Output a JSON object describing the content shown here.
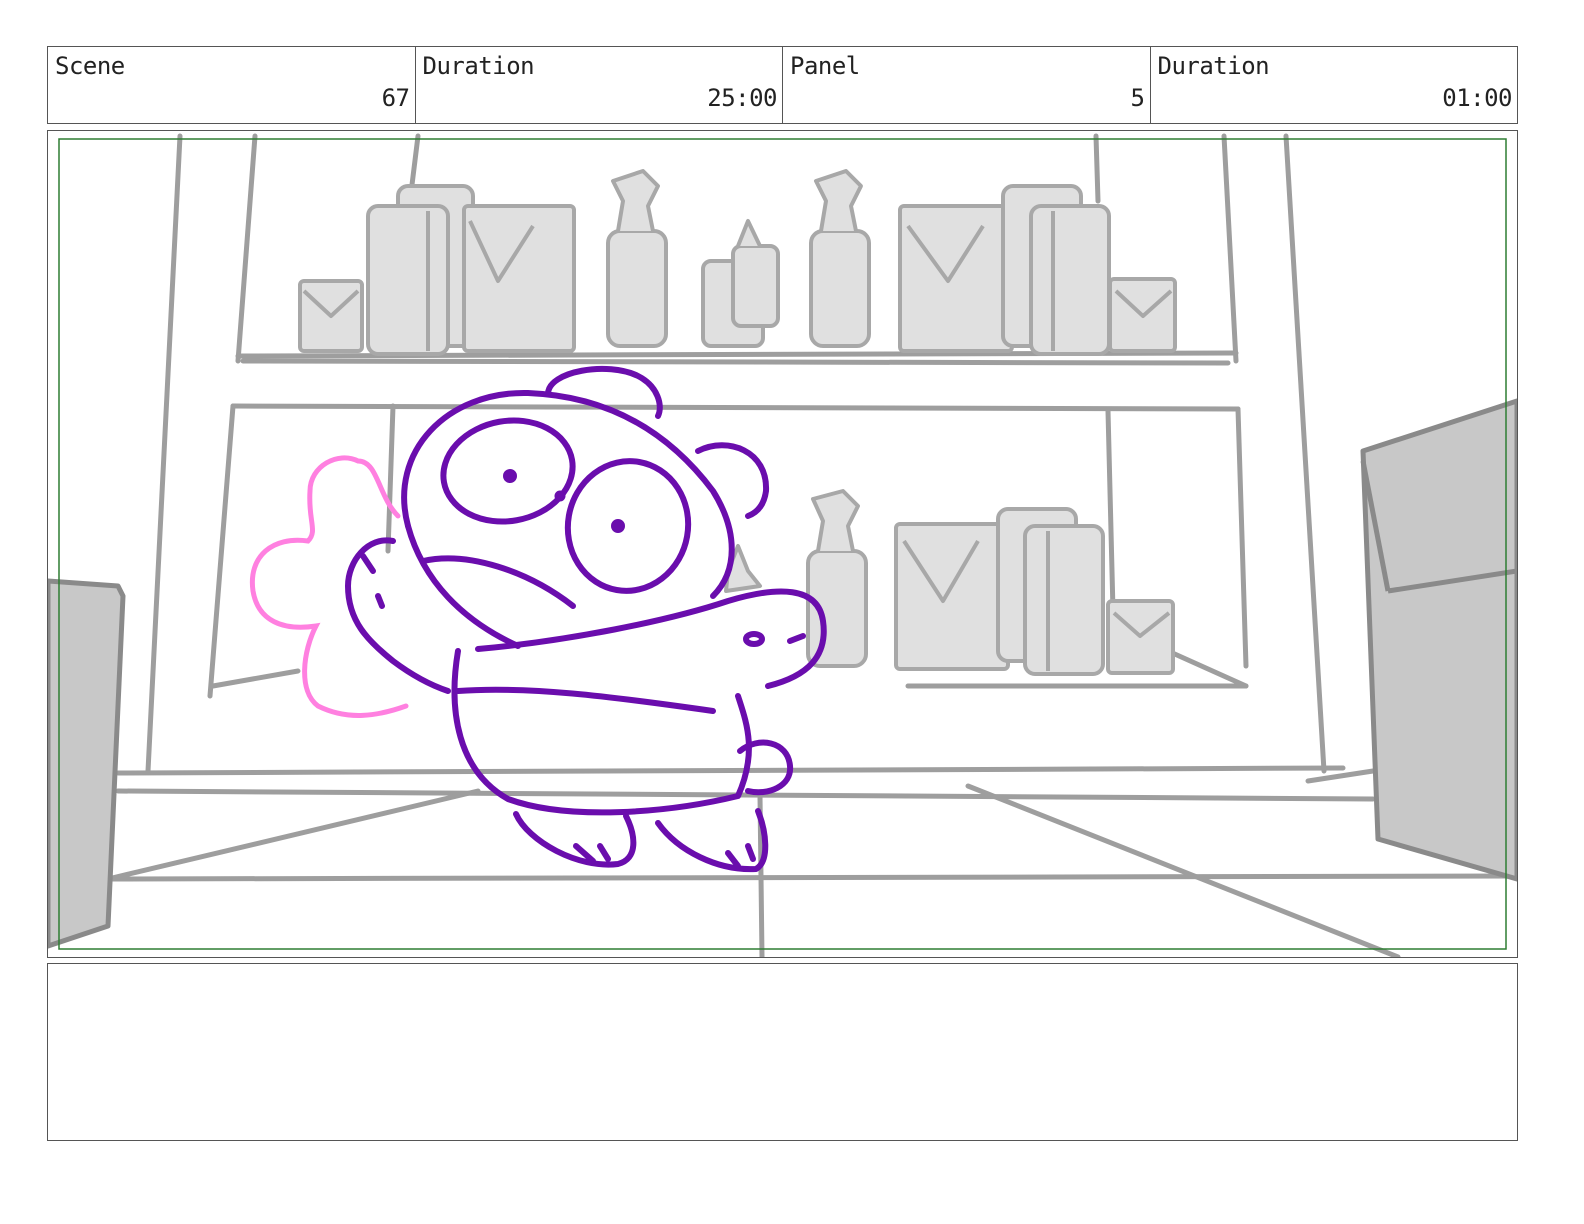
{
  "header": {
    "scene_label": "Scene",
    "scene_value": "67",
    "scene_duration_label": "Duration",
    "scene_duration_value": "25:00",
    "panel_label": "Panel",
    "panel_value": "5",
    "panel_duration_label": "Duration",
    "panel_duration_value": "01:00"
  },
  "colors": {
    "border": "#555555",
    "safe_frame": "#2e7d32",
    "sketch_gray": "#9e9e9e",
    "fill_gray": "#e0e0e0",
    "character_purple": "#6a0dad",
    "effect_pink": "#ff80e0"
  },
  "notes": {
    "text": ""
  }
}
